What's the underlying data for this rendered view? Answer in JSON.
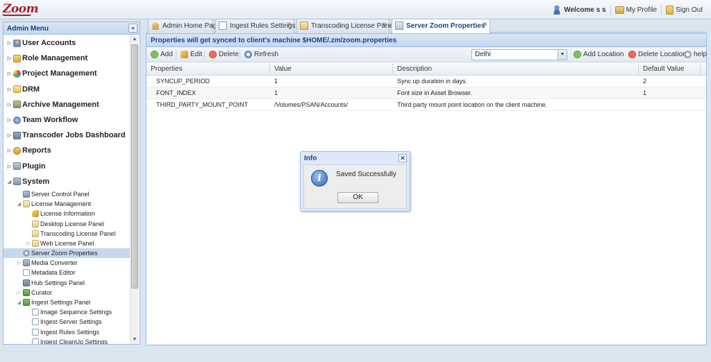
{
  "app": {
    "logo_text": "Zoom"
  },
  "topnav": {
    "welcome": "Welcome s s",
    "my_profile": "My Profile",
    "sign_out": "Sign Out"
  },
  "sidebar": {
    "title": "Admin Menu",
    "collapse_glyph": "«",
    "items": [
      {
        "label": "User Accounts",
        "icon": "user-icon"
      },
      {
        "label": "Role Management",
        "icon": "shield-icon"
      },
      {
        "label": "Project Management",
        "icon": "pie-icon"
      },
      {
        "label": "DRM",
        "icon": "folder-icon"
      },
      {
        "label": "Archive Management",
        "icon": "archive-icon"
      },
      {
        "label": "Team Workflow",
        "icon": "team-icon"
      },
      {
        "label": "Transcoder Jobs Dashboard",
        "icon": "monitor-icon"
      },
      {
        "label": "Reports",
        "icon": "report-icon"
      },
      {
        "label": "Plugin",
        "icon": "plugin-icon"
      },
      {
        "label": "System",
        "icon": "system-icon"
      }
    ],
    "system_children": [
      {
        "label": "Server Control Panel"
      },
      {
        "label": "License Management"
      },
      {
        "label": "License Information"
      },
      {
        "label": "Desktop License Panel"
      },
      {
        "label": "Transcoding License Panel"
      },
      {
        "label": "Web License Panel"
      },
      {
        "label": "Server Zoom Properties"
      },
      {
        "label": "Media Converter"
      },
      {
        "label": "Metadata Editor"
      },
      {
        "label": "Hub Settings Panel"
      },
      {
        "label": "Curator"
      },
      {
        "label": "Ingest Settings Panel"
      },
      {
        "label": "Image Sequence Settings"
      },
      {
        "label": "Ingest Server Settings"
      },
      {
        "label": "Ingest Rules Settings"
      },
      {
        "label": "Ingest CleanUp Settings"
      }
    ]
  },
  "tabs": [
    {
      "label": "Admin Home Page",
      "active": false
    },
    {
      "label": "Ingest Rules Settings",
      "active": false
    },
    {
      "label": "Transcoding License Panel",
      "active": false
    },
    {
      "label": "Server Zoom Properties",
      "active": true
    }
  ],
  "panel": {
    "title": "Properties will get synced to client's machine $HOME/.zm/zoom.properties",
    "toolbar": {
      "add": "Add",
      "edit": "Edit",
      "delete": "Delete",
      "refresh": "Refresh",
      "location_value": "Delhi",
      "add_location": "Add Location",
      "delete_location": "Delete Location",
      "help": "help"
    },
    "columns": [
      "Properties",
      "Value",
      "Description",
      "Default Value"
    ],
    "rows": [
      {
        "property": "SYNCUP_PERIOD",
        "value": "1",
        "description": "Sync up duration in days.",
        "default": "2"
      },
      {
        "property": "FONT_INDEX",
        "value": "1",
        "description": "Font size in Asset Browser.",
        "default": "1"
      },
      {
        "property": "THIRD_PARTY_MOUNT_POINT",
        "value": "/Volumes/PSAN/Accounts/",
        "description": "Third party mount point location on the client machine.",
        "default": ""
      }
    ]
  },
  "dialog": {
    "title": "Info",
    "message": "Saved Successfully",
    "ok": "OK"
  }
}
